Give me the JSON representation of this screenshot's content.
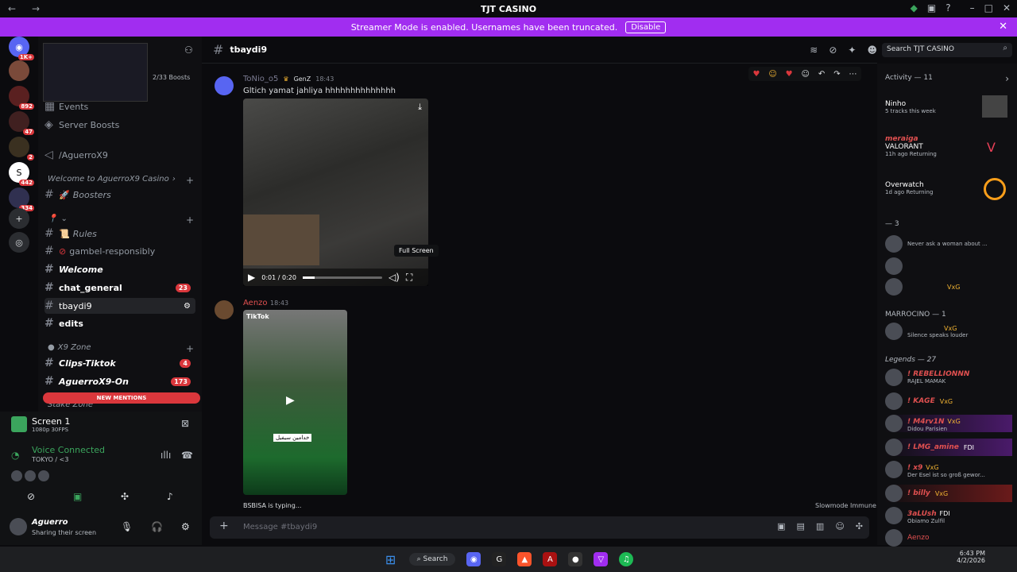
{
  "window": {
    "title": "TJT CASINO"
  },
  "banner": {
    "text": "Streamer Mode is enabled. Usernames have been truncated.",
    "button": "Disable"
  },
  "servers": [
    {
      "badge": "1K+"
    },
    {
      "badge": ""
    },
    {
      "badge": "892"
    },
    {
      "badge": "47"
    },
    {
      "badge": "2"
    },
    {
      "badge": "442"
    },
    {
      "badge": "334"
    }
  ],
  "sidebar": {
    "boosts": "2/33 Boosts",
    "events": "Events",
    "server_boosts": "Server Boosts",
    "aguerro_channel": "/AguerroX9",
    "cat_welcome": "Welcome to AguerroX9 Casino",
    "boosters": "Boosters",
    "rules": "Rules",
    "gamble": "gambel-responsibly",
    "welcome": "Welcome",
    "chat_general": "chat_general",
    "chat_general_badge": "23",
    "tbaydi9": "tbaydi9",
    "edits": "edits",
    "cat_x9": "X9 Zone",
    "clips": "Clips-Tiktok",
    "clips_badge": "4",
    "aguerro_on": "AguerroX9-On",
    "aguerro_on_badge": "173",
    "new_mentions": "NEW MENTIONS",
    "stake": "Stake Zone"
  },
  "panel": {
    "screen_title": "Screen 1",
    "screen_sub": "1080p 30FPS",
    "voice_title": "Voice Connected",
    "voice_sub": "TOKYO / <3",
    "user_name": "Aguerro",
    "user_status": "Sharing their screen"
  },
  "topbar": {
    "channel": "tbaydi9",
    "search_placeholder": "Search TJT CASINO"
  },
  "messages": {
    "m1_author": "ToNio_o5",
    "m1_tag": "GenZ",
    "m1_time": "18:43",
    "m1_text": "Gltich yamat jahliya hhhhhhhhhhhhhh",
    "video_time": "0:01 / 0:20",
    "tooltip": "Full Screen",
    "m2_author": "Aenzo",
    "m2_time": "18:43",
    "tiktok_label": "TikTok",
    "tiktok_caption": "خدامين سيفيل",
    "typing": "BSBISA is typing...",
    "slowmode": "Slowmode Immune"
  },
  "composer": {
    "placeholder": "Message #tbaydi9"
  },
  "members": {
    "activity": "Activity — 11",
    "a1_name": "Ninho",
    "a1_sub": "5 tracks this week",
    "a2_name": "VALORANT",
    "a2_top": "meraiga",
    "a2_sub": "11h ago  Returning",
    "a3_name": "Overwatch",
    "a3_sub": "1d ago  Returning",
    "sec3": "— 3",
    "u1_sub": "Never ask a woman about ...",
    "u3_tag": "VxG",
    "marrocino": "MARROCINO — 1",
    "u4_tag": "VxG",
    "u4_sub": "Silence speaks louder",
    "legends": "Legends — 27",
    "l1": "! REBELLIONNN",
    "l1_sub": "RAJEL MAMAK",
    "l2": "! KAGE",
    "l2_tag": "VxG",
    "l3": "! M4rv1N",
    "l3_tag": "VxG",
    "l3_sub": "Didou Parisien",
    "l4": "! LMG_amine",
    "l4_tag": "FDI",
    "l5": "! x9",
    "l5_tag": "VxG",
    "l5_sub": "Der Esel ist so groß gewor...",
    "l6": "! billy",
    "l6_tag": "VxG",
    "l7": "3aLUsh",
    "l7_tag": "FDI",
    "l7_sub": "Obiamo Zulfil",
    "l8": "Aenzo"
  },
  "taskbar": {
    "search": "Search",
    "time": "6:43 PM",
    "date": "4/2/2026"
  }
}
